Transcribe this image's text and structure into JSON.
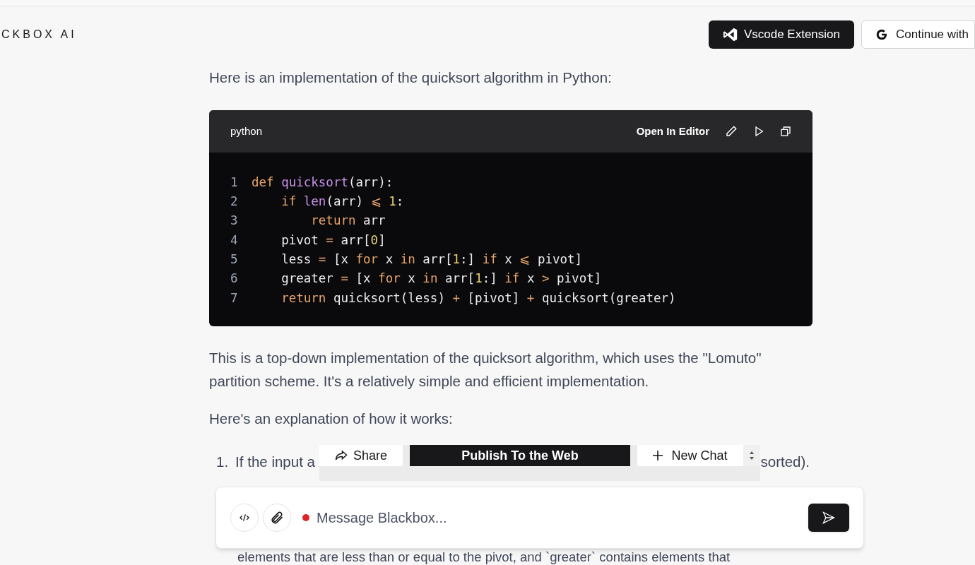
{
  "header": {
    "brand": "CKBOX AI",
    "buttons": [
      {
        "kind": "vscode",
        "label": "Vscode Extension"
      },
      {
        "kind": "google",
        "label": "Continue with"
      }
    ]
  },
  "intro": "Here is an implementation of the quicksort algorithm in Python:",
  "code_block": {
    "language": "python",
    "open_label": "Open In Editor",
    "lines": [
      {
        "number": "1",
        "tokens": [
          {
            "kind": "keyword",
            "text": "def "
          },
          {
            "kind": "function",
            "text": "quicksort"
          },
          {
            "kind": "plain",
            "text": "(arr):"
          }
        ]
      },
      {
        "number": "2",
        "tokens": [
          {
            "kind": "keyword",
            "text": "    if "
          },
          {
            "kind": "function",
            "text": "len"
          },
          {
            "kind": "plain",
            "text": "(arr) "
          },
          {
            "kind": "operator",
            "text": "⩽ "
          },
          {
            "kind": "number",
            "text": "1"
          },
          {
            "kind": "plain",
            "text": ":"
          }
        ]
      },
      {
        "number": "3",
        "tokens": [
          {
            "kind": "keyword",
            "text": "        return "
          },
          {
            "kind": "plain",
            "text": "arr"
          }
        ]
      },
      {
        "number": "4",
        "tokens": [
          {
            "kind": "plain",
            "text": "    pivot "
          },
          {
            "kind": "operator",
            "text": "= "
          },
          {
            "kind": "plain",
            "text": "arr["
          },
          {
            "kind": "number",
            "text": "0"
          },
          {
            "kind": "plain",
            "text": "]"
          }
        ]
      },
      {
        "number": "5",
        "tokens": [
          {
            "kind": "plain",
            "text": "    less "
          },
          {
            "kind": "operator",
            "text": "= "
          },
          {
            "kind": "plain",
            "text": "[x "
          },
          {
            "kind": "keyword",
            "text": "for "
          },
          {
            "kind": "plain",
            "text": "x "
          },
          {
            "kind": "keyword",
            "text": "in "
          },
          {
            "kind": "plain",
            "text": "arr["
          },
          {
            "kind": "number",
            "text": "1"
          },
          {
            "kind": "plain",
            "text": ":] "
          },
          {
            "kind": "keyword",
            "text": "if "
          },
          {
            "kind": "plain",
            "text": "x "
          },
          {
            "kind": "operator",
            "text": "⩽ "
          },
          {
            "kind": "plain",
            "text": "pivot]"
          }
        ]
      },
      {
        "number": "6",
        "tokens": [
          {
            "kind": "plain",
            "text": "    greater "
          },
          {
            "kind": "operator",
            "text": "= "
          },
          {
            "kind": "plain",
            "text": "[x "
          },
          {
            "kind": "keyword",
            "text": "for "
          },
          {
            "kind": "plain",
            "text": "x "
          },
          {
            "kind": "keyword",
            "text": "in "
          },
          {
            "kind": "plain",
            "text": "arr["
          },
          {
            "kind": "number",
            "text": "1"
          },
          {
            "kind": "plain",
            "text": ":] "
          },
          {
            "kind": "keyword",
            "text": "if "
          },
          {
            "kind": "plain",
            "text": "x "
          },
          {
            "kind": "operator",
            "text": "> "
          },
          {
            "kind": "plain",
            "text": "pivot]"
          }
        ]
      },
      {
        "number": "7",
        "tokens": [
          {
            "kind": "keyword",
            "text": "    return "
          },
          {
            "kind": "plain",
            "text": "quicksort(less) "
          },
          {
            "kind": "operator",
            "text": "+ "
          },
          {
            "kind": "plain",
            "text": "[pivot] "
          },
          {
            "kind": "operator",
            "text": "+ "
          },
          {
            "kind": "plain",
            "text": "quicksort(greater)"
          }
        ]
      }
    ]
  },
  "summary": "This is a top-down implementation of the quicksort algorithm, which uses the \"Lomuto\" partition scheme. It's a relatively simple and efficient implementation.",
  "explanation_heading": "Here's an explanation of how it works:",
  "list_item": {
    "number": "1.",
    "text_start": "If the input a",
    "text_end": "sorted)."
  },
  "toolbar": {
    "share": "Share",
    "publish": "Publish To the Web",
    "new_chat": "New Chat"
  },
  "composer": {
    "placeholder": "Message Blackbox...",
    "recording": true
  },
  "bottom_line": "elements that are less than or equal to the pivot, and `greater` contains elements that"
}
